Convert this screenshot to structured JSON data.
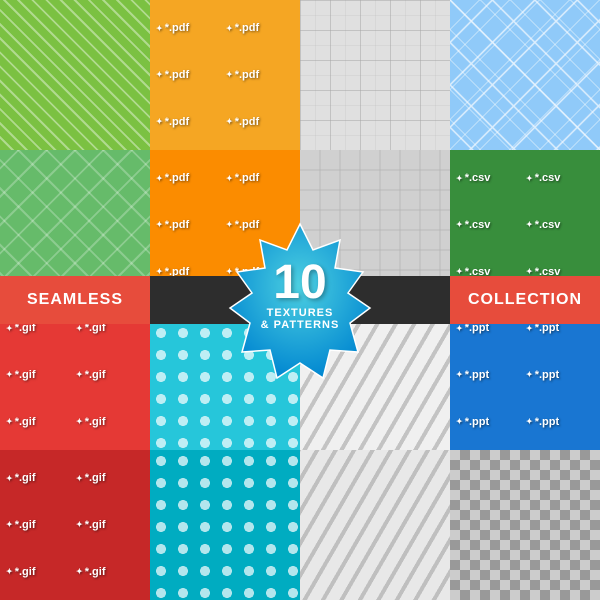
{
  "badge": {
    "number": "10",
    "line1": "TEXTURES",
    "line2": "& PATTERNS"
  },
  "banners": {
    "left": "SEAMLESS",
    "center_line1": "TEXTURES",
    "center_line2": "& PATTERNS",
    "right": "COLLECTION"
  },
  "cells": {
    "top_row": [
      "diag-green",
      "pdf-orange",
      "grid-gray",
      "diamonds-blue",
      "csv-green",
      "csv-dark"
    ],
    "bottom_row": [
      "gif-red",
      "dots-teal",
      "stripes-light",
      "ppt-blue",
      "checker"
    ]
  },
  "file_types": {
    "pdf": "*.pdf",
    "csv": "*.csv",
    "gif": "*.gif",
    "ppt": "*.ppt"
  },
  "colors": {
    "green": "#7bc142",
    "orange": "#f5a623",
    "red": "#e74c3c",
    "blue": "#3498db",
    "teal": "#26c6da",
    "badge_blue": "#29b6d8",
    "dark": "#3d3d3d",
    "csv_green": "#4caf50",
    "pdf_orange": "#ff9800",
    "gif_red": "#e53935",
    "ppt_blue": "#1565c0"
  }
}
